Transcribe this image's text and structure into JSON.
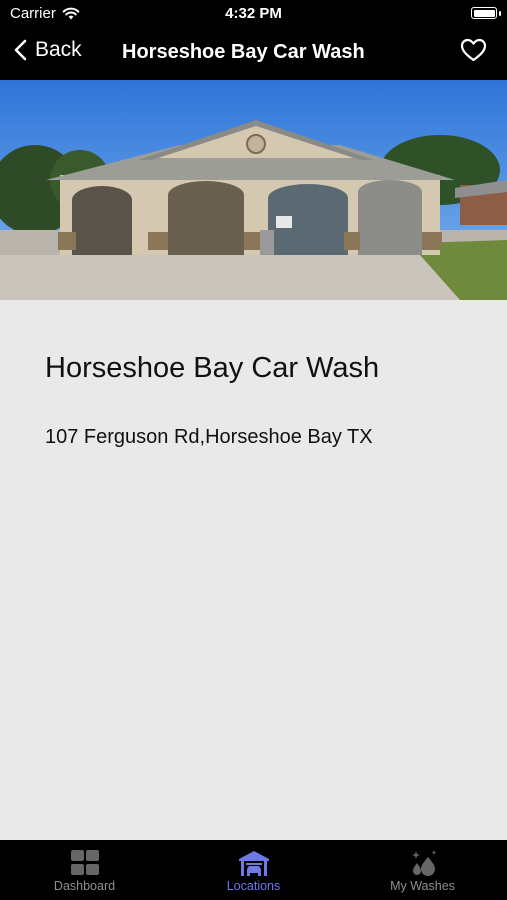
{
  "status": {
    "carrier": "Carrier",
    "time": "4:32 PM",
    "battery_level": 1.0
  },
  "nav": {
    "back_label": "Back",
    "title": "Horseshoe Bay Car Wash",
    "favorite_icon": "heart-outline-icon"
  },
  "location": {
    "name": "Horseshoe Bay Car Wash",
    "address": "107 Ferguson Rd,Horseshoe Bay TX"
  },
  "tabs": [
    {
      "label": "Dashboard",
      "icon": "grid-icon",
      "active": false
    },
    {
      "label": "Locations",
      "icon": "car-wash-icon",
      "active": true
    },
    {
      "label": "My Washes",
      "icon": "droplets-icon",
      "active": false
    }
  ],
  "colors": {
    "accent": "#6f78e8",
    "bar": "#000000",
    "background": "#e9e9e9",
    "inactive": "#8e8e93"
  }
}
